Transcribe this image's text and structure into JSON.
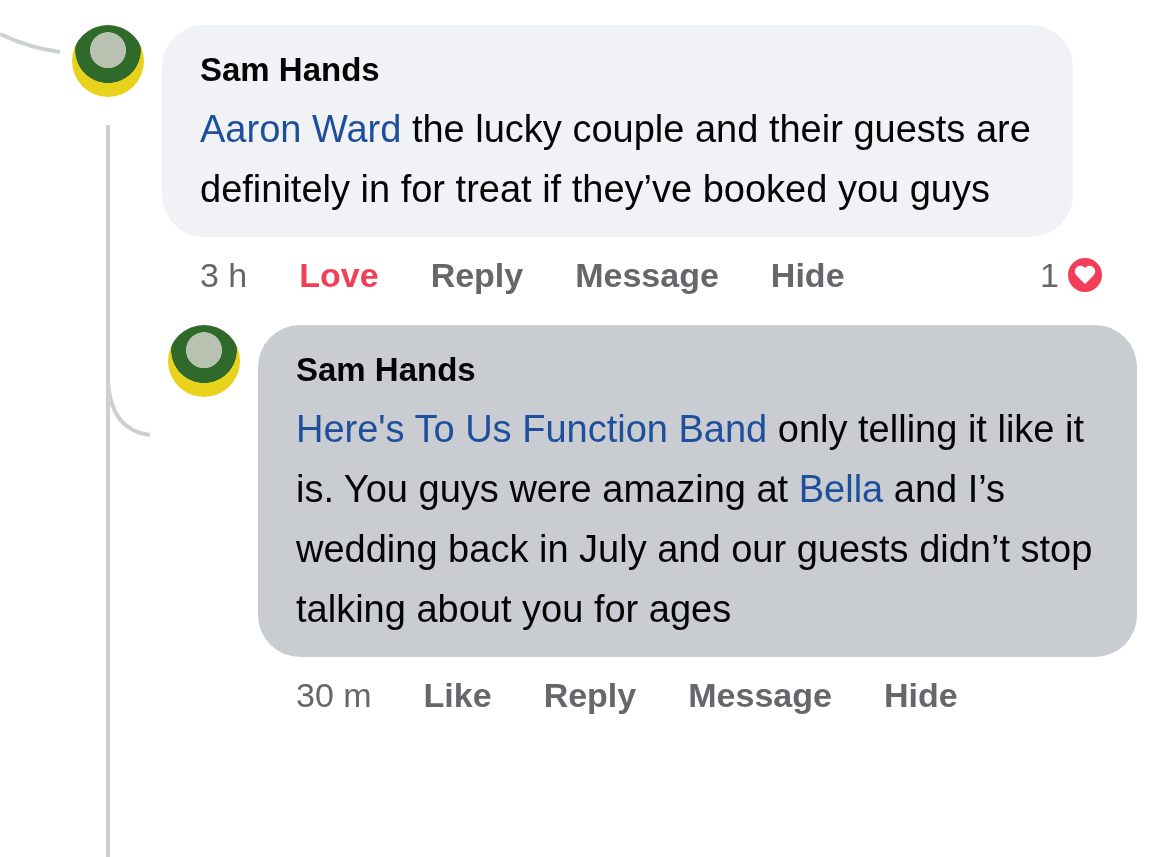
{
  "comments": [
    {
      "author": "Sam Hands",
      "highlighted": false,
      "body": [
        {
          "kind": "mention",
          "text": "Aaron Ward"
        },
        {
          "kind": "text",
          "text": " the lucky couple and their guests are definitely in for treat if they’ve booked you guys"
        }
      ],
      "time": "3 h",
      "reaction": {
        "label": "Love",
        "active": true
      },
      "actions": [
        "Reply",
        "Message",
        "Hide"
      ],
      "reaction_count": "1"
    },
    {
      "author": "Sam Hands",
      "highlighted": true,
      "body": [
        {
          "kind": "mention",
          "text": "Here's To Us Function Band"
        },
        {
          "kind": "text",
          "text": " only telling it like it is. You guys were amazing at "
        },
        {
          "kind": "mention",
          "text": "Bella"
        },
        {
          "kind": "text",
          "text": " and I’s wedding back in July and our guests didn’t stop talking about you for ages"
        }
      ],
      "time": "30 m",
      "reaction": {
        "label": "Like",
        "active": false
      },
      "actions": [
        "Reply",
        "Message",
        "Hide"
      ]
    }
  ]
}
